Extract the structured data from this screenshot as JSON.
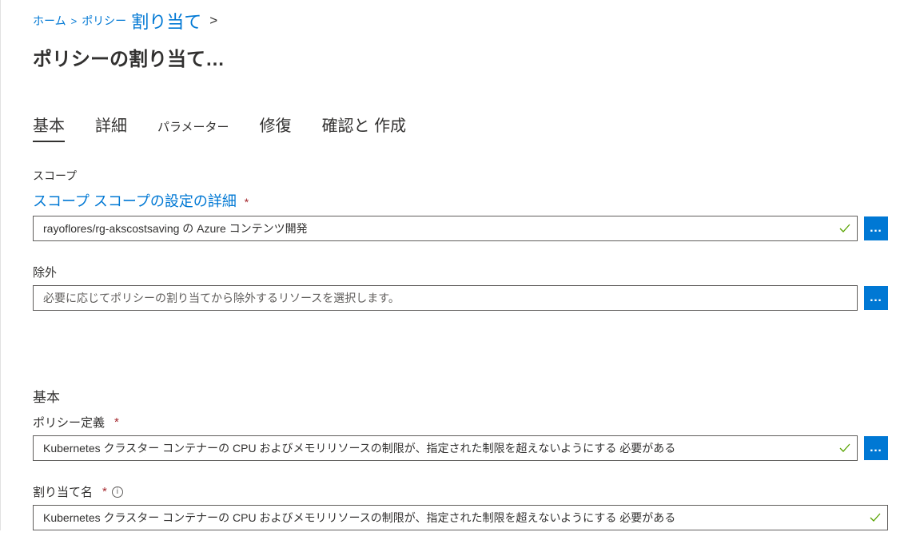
{
  "breadcrumb": {
    "home": "ホーム",
    "policy": "ポリシー",
    "assignment": "割り当て"
  },
  "page_title": "ポリシーの割り当て…",
  "tabs": {
    "basic": "基本",
    "advanced": "詳細",
    "parameters": "パラメーター",
    "remediation": "修復",
    "review_create": "確認と 作成"
  },
  "scope": {
    "section_label": "スコープ",
    "link_text": "スコープ スコープの設定の詳細",
    "value": "rayoflores/rg-akscostsaving の Azure コンテンツ開発"
  },
  "exclusions": {
    "label": "除外",
    "placeholder": "必要に応じてポリシーの割り当てから除外するリソースを選択します。"
  },
  "basics": {
    "heading": "基本",
    "policy_definition_label": "ポリシー定義",
    "policy_definition_value": "Kubernetes クラスター コンテナーの CPU およびメモリリソースの制限が、指定された制限を超えないようにする 必要がある",
    "assignment_name_label": "割り当て名",
    "assignment_name_value": "Kubernetes クラスター コンテナーの CPU およびメモリリソースの制限が、指定された制限を超えないようにする 必要がある"
  },
  "glyphs": {
    "required": "*",
    "ellipsis": "…",
    "sep": ">",
    "info": "i"
  }
}
